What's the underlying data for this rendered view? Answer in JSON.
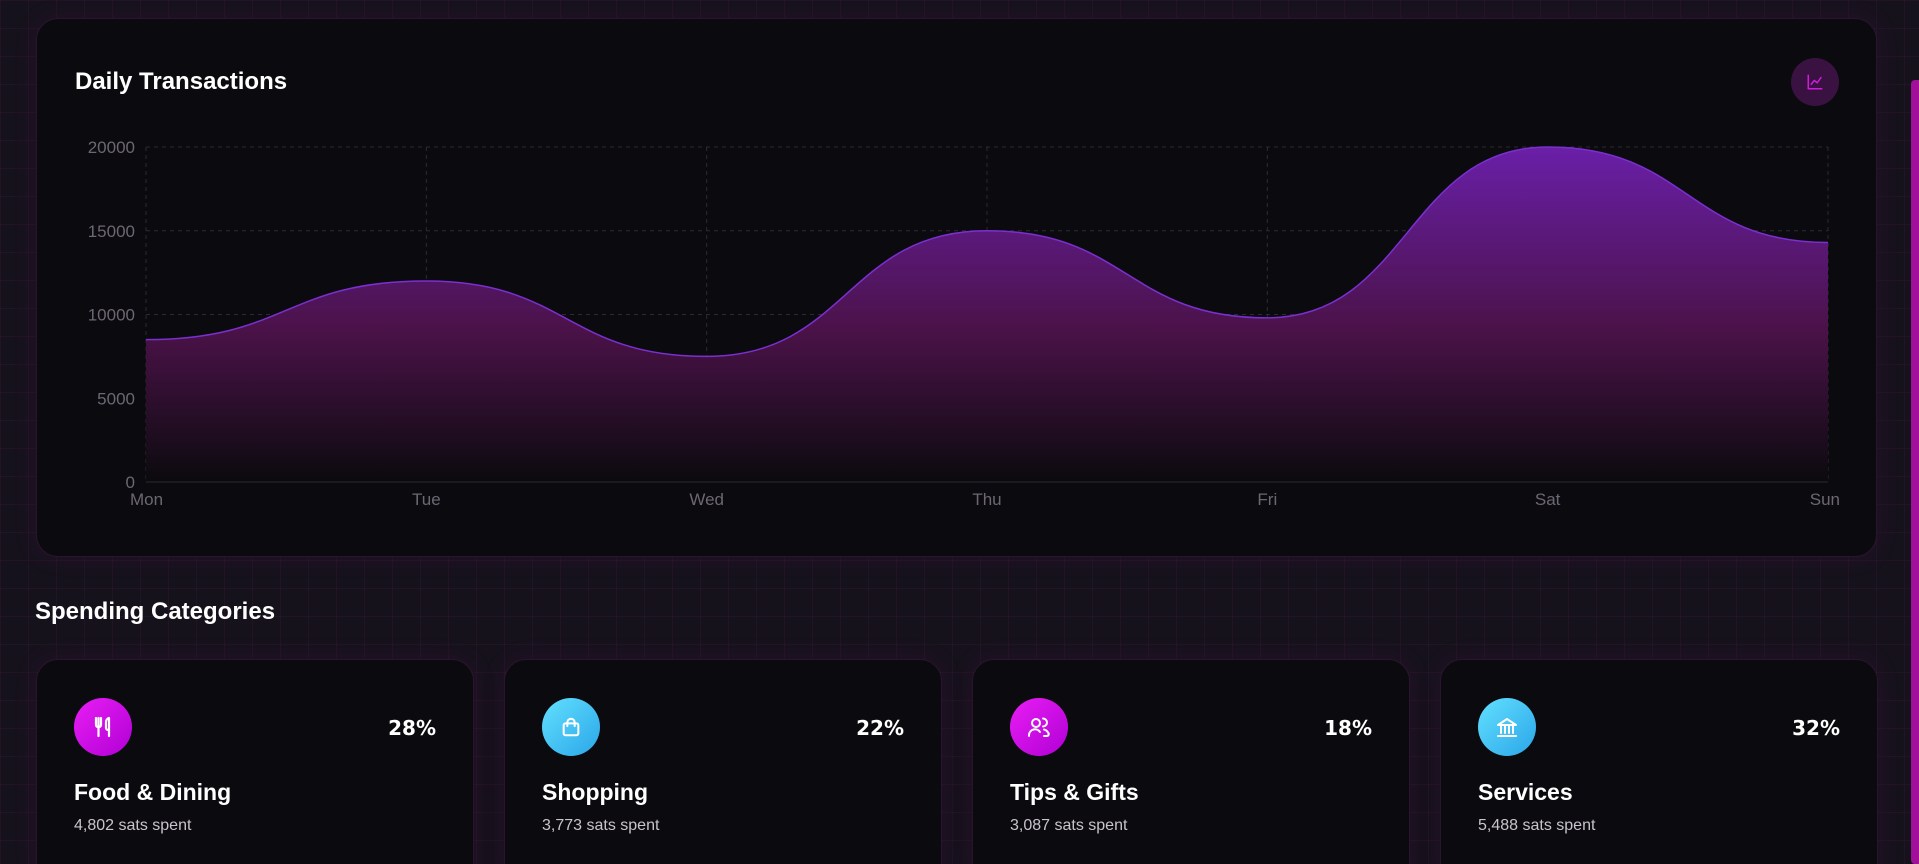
{
  "chart": {
    "title": "Daily Transactions",
    "icon": "chart-line-icon"
  },
  "chart_data": {
    "type": "area",
    "title": "Daily Transactions",
    "xlabel": "",
    "ylabel": "",
    "categories": [
      "Mon",
      "Tue",
      "Wed",
      "Thu",
      "Fri",
      "Sat",
      "Sun"
    ],
    "values": [
      8500,
      12000,
      7500,
      15000,
      9800,
      20000,
      14300
    ],
    "ylim": [
      0,
      20000
    ],
    "yticks": [
      "0",
      "5000",
      "10000",
      "15000",
      "20000"
    ],
    "grid": true,
    "line_color": "#7b2fd0",
    "fill_top_color": "#6a1fa8",
    "fill_bottom_color": "#0b0a0e"
  },
  "categories_section": {
    "title": "Spending Categories",
    "items": [
      {
        "name": "Food & Dining",
        "percent": "28%",
        "spent": "4,802 sats spent",
        "icon": "utensils-icon",
        "color": "magenta"
      },
      {
        "name": "Shopping",
        "percent": "22%",
        "spent": "3,773 sats spent",
        "icon": "shopping-bag-icon",
        "color": "cyan"
      },
      {
        "name": "Tips & Gifts",
        "percent": "18%",
        "spent": "3,087 sats spent",
        "icon": "users-icon",
        "color": "magenta"
      },
      {
        "name": "Services",
        "percent": "32%",
        "spent": "5,488 sats spent",
        "icon": "bank-icon",
        "color": "cyan"
      }
    ]
  },
  "colors": {
    "accent_magenta": "#e91ef5",
    "accent_cyan": "#4cc8f5",
    "card_bg": "#0b0a0e",
    "page_bg": "#16121c"
  }
}
